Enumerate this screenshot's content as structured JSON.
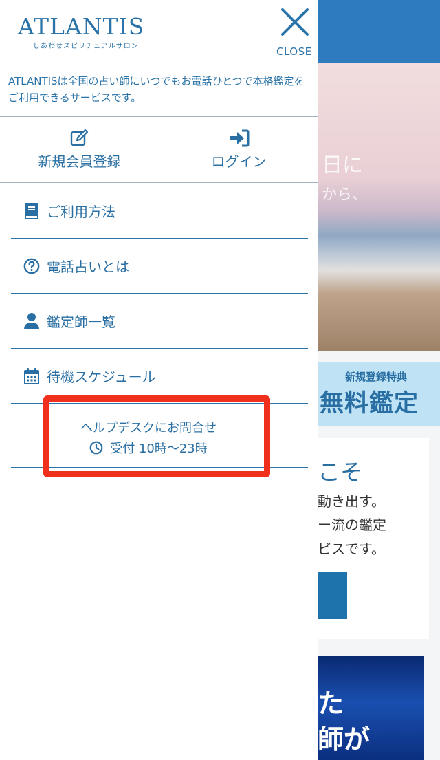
{
  "drawer": {
    "logo": {
      "main": "ATLANTIS",
      "sub": "しあわせスピリチュアルサロン"
    },
    "close_label": "CLOSE",
    "description": "ATLANTISは全国の占い師にいつでもお電話ひとつで本格鑑定をご利用できるサービスです。",
    "auth": {
      "register": {
        "label": "新規会員登録",
        "icon": "edit-icon"
      },
      "login": {
        "label": "ログイン",
        "icon": "login-icon"
      }
    },
    "menu": [
      {
        "label": "ご利用方法",
        "icon": "book-icon"
      },
      {
        "label": "電話占いとは",
        "icon": "question-circle-icon"
      },
      {
        "label": "鑑定師一覧",
        "icon": "user-icon"
      },
      {
        "label": "待機スケジュール",
        "icon": "calendar-icon"
      }
    ],
    "helpdesk": {
      "title": "ヘルプデスクにお問合せ",
      "hours": "受付 10時〜23時",
      "icon": "clock-icon"
    }
  },
  "background_page": {
    "hero_lines": [
      "日に",
      "から、"
    ],
    "campaign_small": "新規登録特典",
    "campaign_big": "無料鑑定",
    "card_heading": "こそ",
    "card_lines": [
      "動き出す。",
      "ー流の鑑定",
      "ビスです。"
    ],
    "banner_lines": [
      "た",
      "師が"
    ]
  },
  "colors": {
    "brand": "#2a73a8",
    "highlight": "#f0301c",
    "divider": "#9fb2c2"
  }
}
